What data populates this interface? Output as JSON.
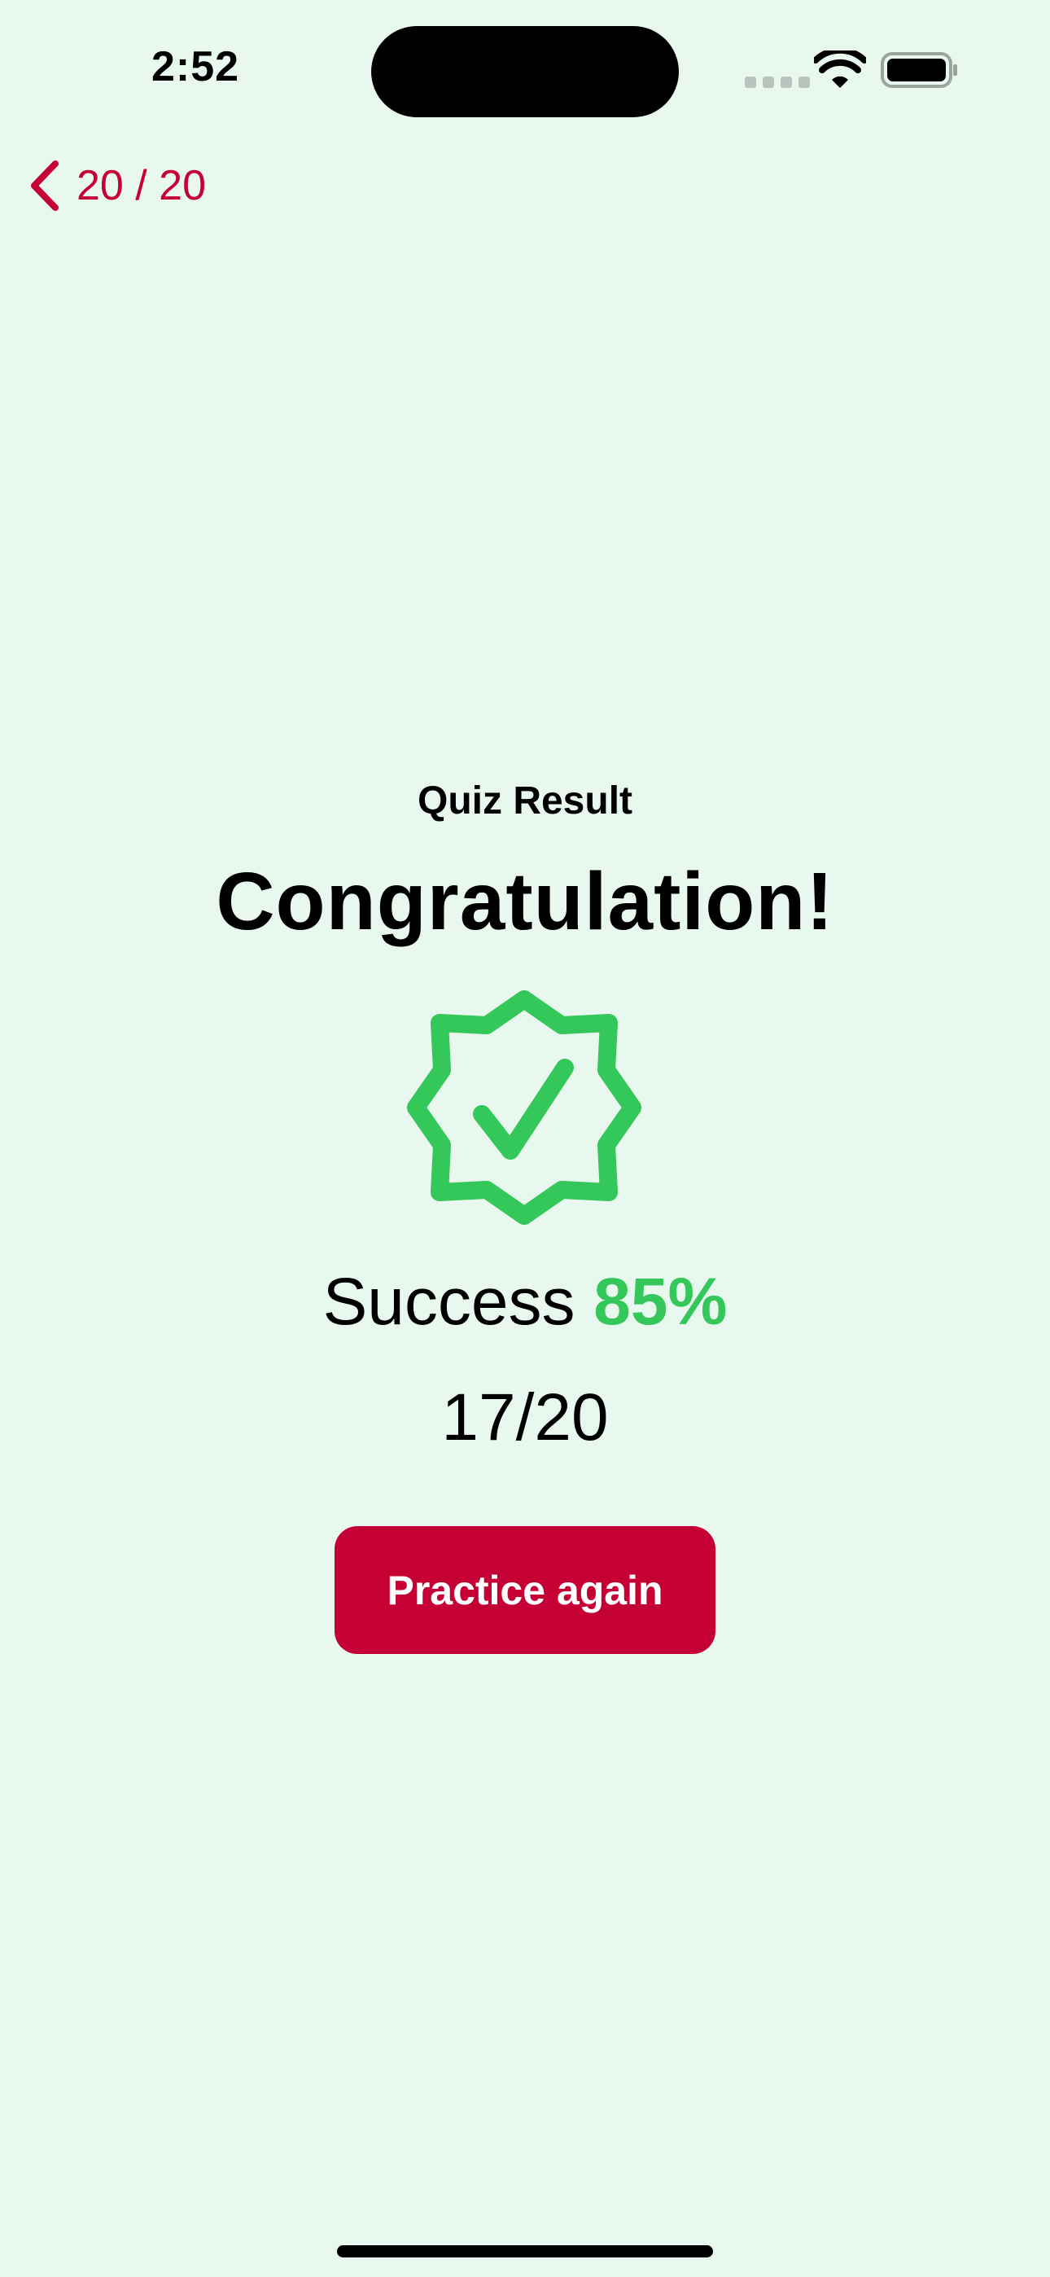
{
  "status_bar": {
    "time": "2:52"
  },
  "nav": {
    "back_label": "20 / 20"
  },
  "result": {
    "title": "Quiz Result",
    "headline": "Congratulation!",
    "success_label": "Success",
    "success_percent": "85%",
    "score": "17/20",
    "practice_button_label": "Practice again"
  },
  "icons": {
    "back": "chevron-left-icon",
    "badge": "checkmark-seal-icon",
    "wifi": "wifi-icon",
    "battery": "battery-icon"
  },
  "colors": {
    "background": "#e9f8ee",
    "accent": "#c40035",
    "success": "#34c759"
  }
}
